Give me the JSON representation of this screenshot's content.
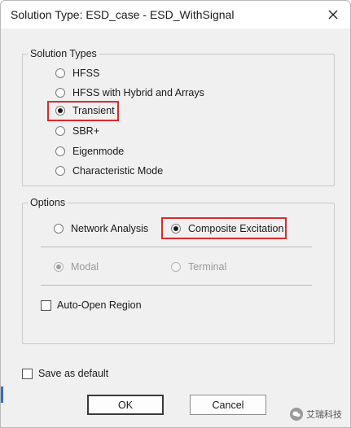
{
  "window": {
    "title": "Solution Type: ESD_case - ESD_WithSignal",
    "close_icon": "close-icon"
  },
  "solution_types": {
    "legend": "Solution Types",
    "options": [
      {
        "label": "HFSS",
        "checked": false
      },
      {
        "label": "HFSS with Hybrid and Arrays",
        "checked": false
      },
      {
        "label": "Transient",
        "checked": true
      },
      {
        "label": "SBR+",
        "checked": false
      },
      {
        "label": "Eigenmode",
        "checked": false
      },
      {
        "label": "Characteristic Mode",
        "checked": false
      }
    ]
  },
  "options": {
    "legend": "Options",
    "network_analysis": {
      "label": "Network Analysis",
      "checked": false
    },
    "composite_excitation": {
      "label": "Composite Excitation",
      "checked": true
    },
    "modal": {
      "label": "Modal",
      "checked": true,
      "enabled": false
    },
    "terminal": {
      "label": "Terminal",
      "checked": false,
      "enabled": false
    },
    "auto_open_region": {
      "label": "Auto-Open Region",
      "checked": false
    }
  },
  "save_as_default": {
    "label": "Save as default",
    "checked": false
  },
  "buttons": {
    "ok": "OK",
    "cancel": "Cancel"
  },
  "watermark": {
    "text": "艾瑞科技"
  },
  "colors": {
    "highlight": "#e0282c",
    "dialog_bg": "#f0f0f0",
    "titlebar_bg": "#ffffff"
  }
}
